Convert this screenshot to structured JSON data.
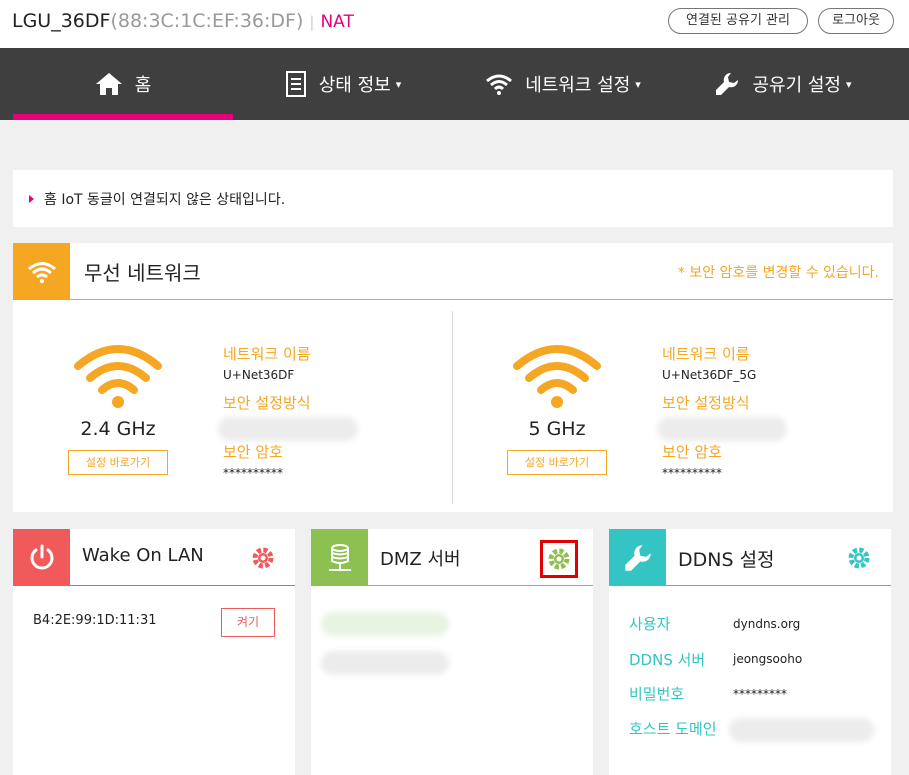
{
  "header": {
    "device_name": "LGU_36DF",
    "mac": "(88:3C:1C:EF:36:DF)",
    "separator": "|",
    "mode": "NAT",
    "manage_button": "연결된 공유기 관리",
    "logout_button": "로그아웃"
  },
  "nav": {
    "items": [
      {
        "label": "홈",
        "icon": "home-icon"
      },
      {
        "label": "상태 정보",
        "icon": "document-icon"
      },
      {
        "label": "네트워크 설정",
        "icon": "wifi-icon"
      },
      {
        "label": "공유기 설정",
        "icon": "wrench-icon"
      }
    ],
    "caret": "▾",
    "active_index": 0
  },
  "notice": "홈 IoT 동글이 연결되지 않은 상태입니다.",
  "wireless": {
    "title": "무선 네트워크",
    "note": "* 보안 암호를 변경할 수 있습니다.",
    "bands": [
      {
        "freq": "2.4 GHz",
        "button": "설정 바로가기",
        "name_label": "네트워크 이름",
        "name": "U+Net36DF",
        "security_label": "보안 설정방식",
        "password_label": "보안 암호",
        "password": "**********"
      },
      {
        "freq": "5 GHz",
        "button": "설정 바로가기",
        "name_label": "네트워크 이름",
        "name": "U+Net36DF_5G",
        "security_label": "보안 설정방식",
        "password_label": "보안 암호",
        "password": "**********"
      }
    ]
  },
  "wol": {
    "title": "Wake On LAN",
    "mac": "B4:2E:99:1D:11:31",
    "button": "켜기"
  },
  "dmz": {
    "title": "DMZ 서버"
  },
  "ddns": {
    "title": "DDNS 설정",
    "rows": [
      {
        "label": "사용자",
        "value": "dyndns.org"
      },
      {
        "label": "DDNS 서버",
        "value": "jeongsooho"
      },
      {
        "label": "비밀번호",
        "value": "*********"
      },
      {
        "label": "호스트 도메인",
        "value": ""
      }
    ]
  },
  "colors": {
    "accent": "#e5007e",
    "wireless": "#f5a623",
    "wol": "#f05a5a",
    "dmz": "#8cc152",
    "ddns": "#35c4c4",
    "nav_bg": "#3f3f3f",
    "highlight_box": "#e00000"
  }
}
